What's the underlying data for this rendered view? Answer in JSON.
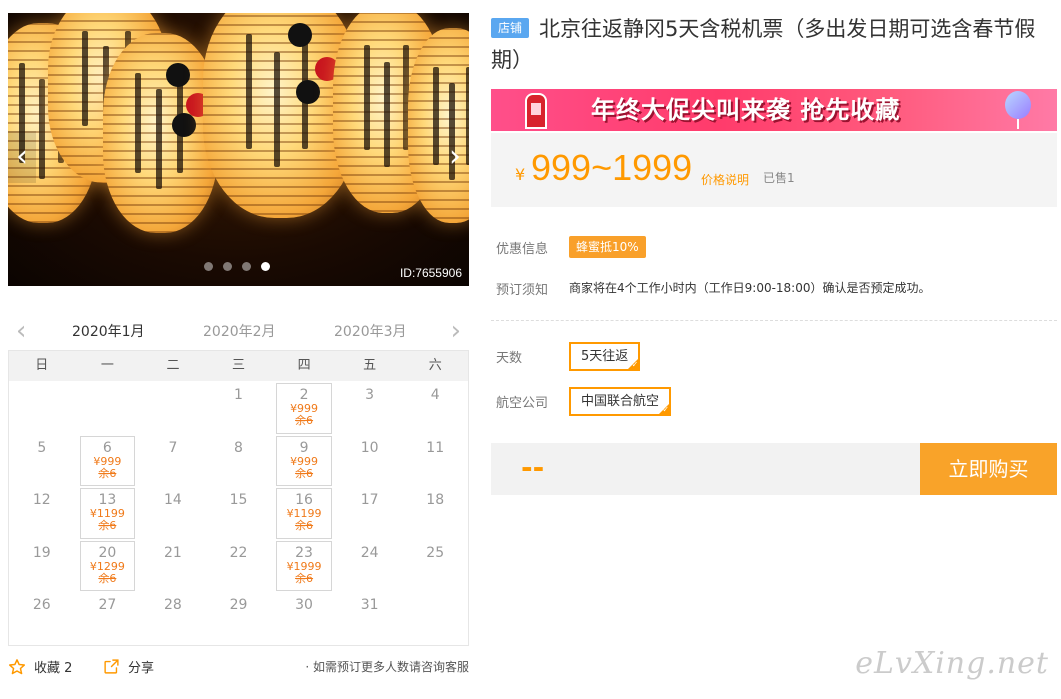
{
  "gallery": {
    "image_id": "ID:7655906",
    "slides": 4,
    "active_slide": 4,
    "prev_glyph": "‹",
    "next_glyph": "›"
  },
  "calendar": {
    "months": [
      "2020年1月",
      "2020年2月",
      "2020年3月"
    ],
    "active_month": "2020年1月",
    "weekdays": [
      "日",
      "一",
      "二",
      "三",
      "四",
      "五",
      "六"
    ],
    "leading_blanks": 3,
    "days": [
      {
        "day": "1"
      },
      {
        "day": "2",
        "price": "¥999",
        "stock": "余6"
      },
      {
        "day": "3"
      },
      {
        "day": "4"
      },
      {
        "day": "5"
      },
      {
        "day": "6",
        "price": "¥999",
        "stock": "余6"
      },
      {
        "day": "7"
      },
      {
        "day": "8"
      },
      {
        "day": "9",
        "price": "¥999",
        "stock": "余6"
      },
      {
        "day": "10"
      },
      {
        "day": "11"
      },
      {
        "day": "12"
      },
      {
        "day": "13",
        "price": "¥1199",
        "stock": "余6"
      },
      {
        "day": "14"
      },
      {
        "day": "15"
      },
      {
        "day": "16",
        "price": "¥1199",
        "stock": "余6"
      },
      {
        "day": "17"
      },
      {
        "day": "18"
      },
      {
        "day": "19"
      },
      {
        "day": "20",
        "price": "¥1299",
        "stock": "余6"
      },
      {
        "day": "21"
      },
      {
        "day": "22"
      },
      {
        "day": "23",
        "price": "¥1999",
        "stock": "余6"
      },
      {
        "day": "24"
      },
      {
        "day": "25"
      },
      {
        "day": "26"
      },
      {
        "day": "27"
      },
      {
        "day": "28"
      },
      {
        "day": "29"
      },
      {
        "day": "30"
      },
      {
        "day": "31"
      }
    ]
  },
  "bottom": {
    "favorite_label": "收藏 2",
    "share_label": "分享",
    "consult_text": "· 如需预订更多人数请咨询客服"
  },
  "product": {
    "shop_tag": "店铺",
    "title": "北京往返静冈5天含税机票（多出发日期可选含春节假期）",
    "banner_text": "年终大促尖叫来袭  抢先收藏",
    "price_symbol": "¥",
    "price_range": "999~1999",
    "price_explain": "价格说明",
    "sold": "已售1"
  },
  "info": {
    "promo_label": "优惠信息",
    "promo_badge": "蜂蜜抵10%",
    "notice_label": "预订须知",
    "notice_text": "商家将在4个工作小时内（工作日9:00-18:00）确认是否预定成功。"
  },
  "options": {
    "days_label": "天数",
    "days_value": "5天往返",
    "airline_label": "航空公司",
    "airline_value": "中国联合航空"
  },
  "purchase": {
    "total": "--",
    "buy_label": "立即购买"
  },
  "watermark": "eLvXing.net",
  "colors": {
    "accent": "#ff9900",
    "shop_tag": "#5aa7f0",
    "banner": "#ff3b6b"
  }
}
